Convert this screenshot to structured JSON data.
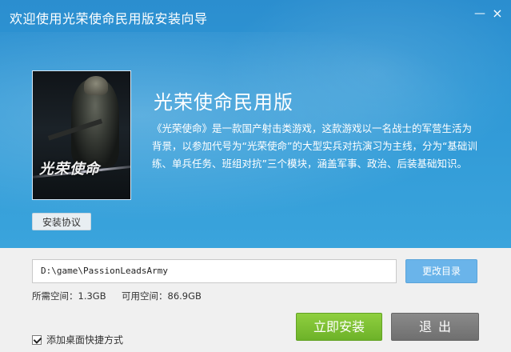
{
  "window": {
    "title": "欢迎使用光荣使命民用版安装向导",
    "minimize_glyph": "—",
    "close_glyph": "×"
  },
  "game": {
    "name": "光荣使命民用版",
    "cover_logo": "光荣使命",
    "description": "《光荣使命》是一款国产射击类游戏，这款游戏以一名战士的军营生活为背景，以参加代号为“光荣使命”的大型实兵对抗演习为主线，分为“基础训练、单兵任务、班组对抗”三个模块，涵盖军事、政治、后装基础知识。"
  },
  "buttons": {
    "agreement": "安装协议",
    "change_dir": "更改目录",
    "install": "立即安装",
    "exit": "退出"
  },
  "install": {
    "path": "D:\\game\\PassionLeadsArmy",
    "required_label": "所需空间：",
    "required_value": "1.3GB",
    "available_label": "可用空间：",
    "available_value": "86.9GB",
    "shortcut_label": "添加桌面快捷方式",
    "shortcut_checked": true
  },
  "colors": {
    "hero_blue": "#2f98d6",
    "install_green": "#7cc035",
    "exit_gray": "#7a7a7a",
    "dir_button_blue": "#6ab4ea"
  },
  "icons": {
    "minimize": "minimize-icon",
    "close": "close-icon",
    "checkbox": "checkmark-icon"
  }
}
